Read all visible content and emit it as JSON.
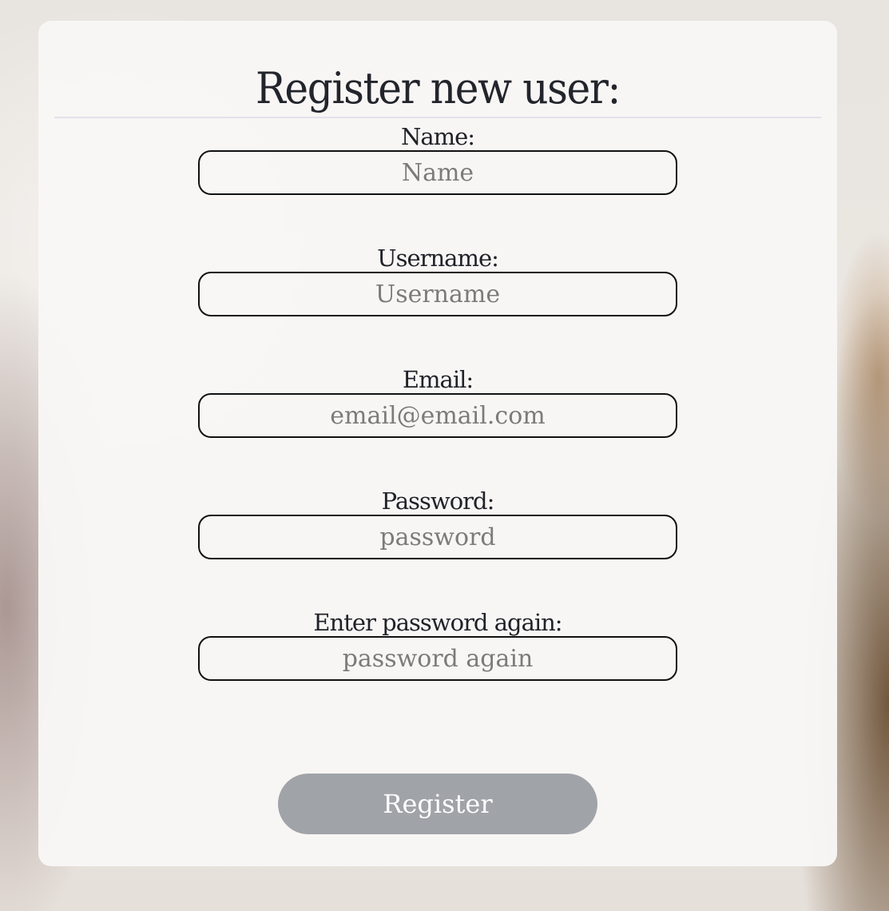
{
  "form": {
    "title": "Register new user:",
    "fields": [
      {
        "label": "Name:",
        "placeholder": "Name",
        "value": ""
      },
      {
        "label": "Username:",
        "placeholder": "Username",
        "value": ""
      },
      {
        "label": "Email:",
        "placeholder": "email@email.com",
        "value": ""
      },
      {
        "label": "Password:",
        "placeholder": "password",
        "value": ""
      },
      {
        "label": "Enter password again:",
        "placeholder": "password again",
        "value": ""
      }
    ],
    "submit_label": "Register"
  },
  "colors": {
    "title_text": "#22252b",
    "input_border": "#111111",
    "placeholder_text": "#7b7b7b",
    "button_background": "#a0a3a8",
    "button_text": "#ffffff",
    "card_background": "#f8f7f6"
  }
}
